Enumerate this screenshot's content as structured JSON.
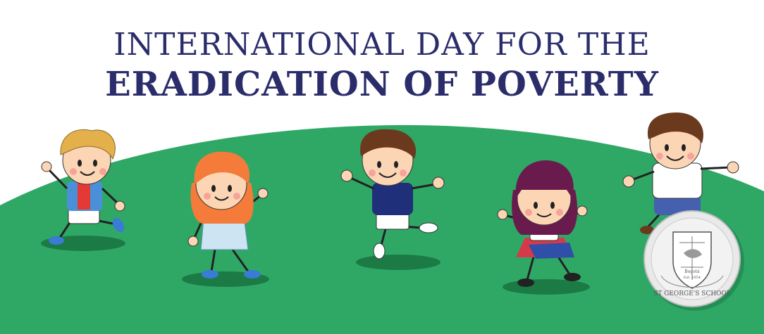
{
  "banner": {
    "title_line1": "INTERNATIONAL DAY FOR THE",
    "title_line2": "ERADICATION OF POVERTY"
  },
  "seal": {
    "text": "ST GEORGE'S SCHOOL",
    "motto": "Bogotá",
    "established": "Est. 1954"
  },
  "colors": {
    "background": "#ffffff",
    "hill": "#2fa866",
    "title": "#2b2d6b",
    "shadow": "#1c7a45"
  }
}
